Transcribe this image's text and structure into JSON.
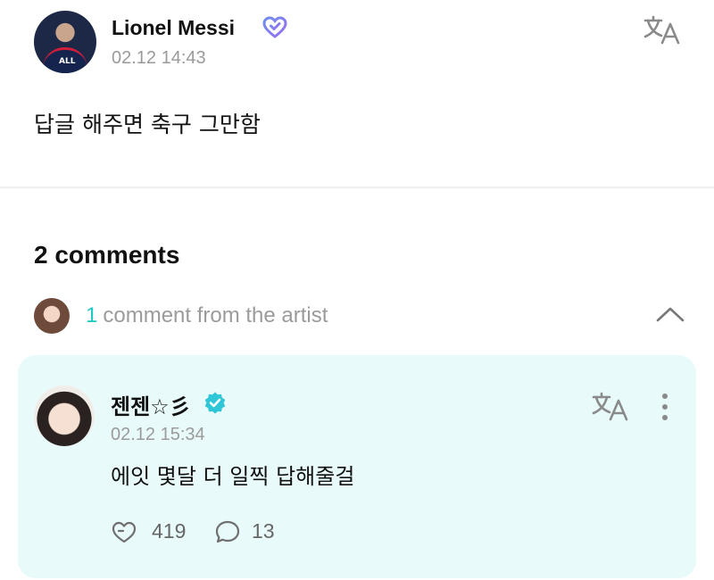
{
  "post": {
    "author": "Lionel Messi",
    "timestamp": "02.12 14:43",
    "body": "답글 해주면 축구 그만함",
    "icons": {
      "badge": "heart-icon",
      "translate": "translate-icon"
    }
  },
  "comments": {
    "count_label": "2 comments",
    "artist_summary": {
      "count": "1",
      "label": "comment from the artist",
      "icon": "chevron-up-icon",
      "accent_color": "#1fc6c6"
    },
    "items": [
      {
        "author": "젠젠☆彡",
        "timestamp": "02.12 15:34",
        "body": "에잇 몇달 더 일찍 답해줄걸",
        "likes": "419",
        "replies": "13",
        "verified_color": "#2fc6d7",
        "icons": {
          "badge": "verified-icon",
          "translate": "translate-icon",
          "menu": "more-icon",
          "like": "like-icon",
          "reply": "reply-icon"
        }
      }
    ],
    "card_background": "#e8fbfa"
  }
}
